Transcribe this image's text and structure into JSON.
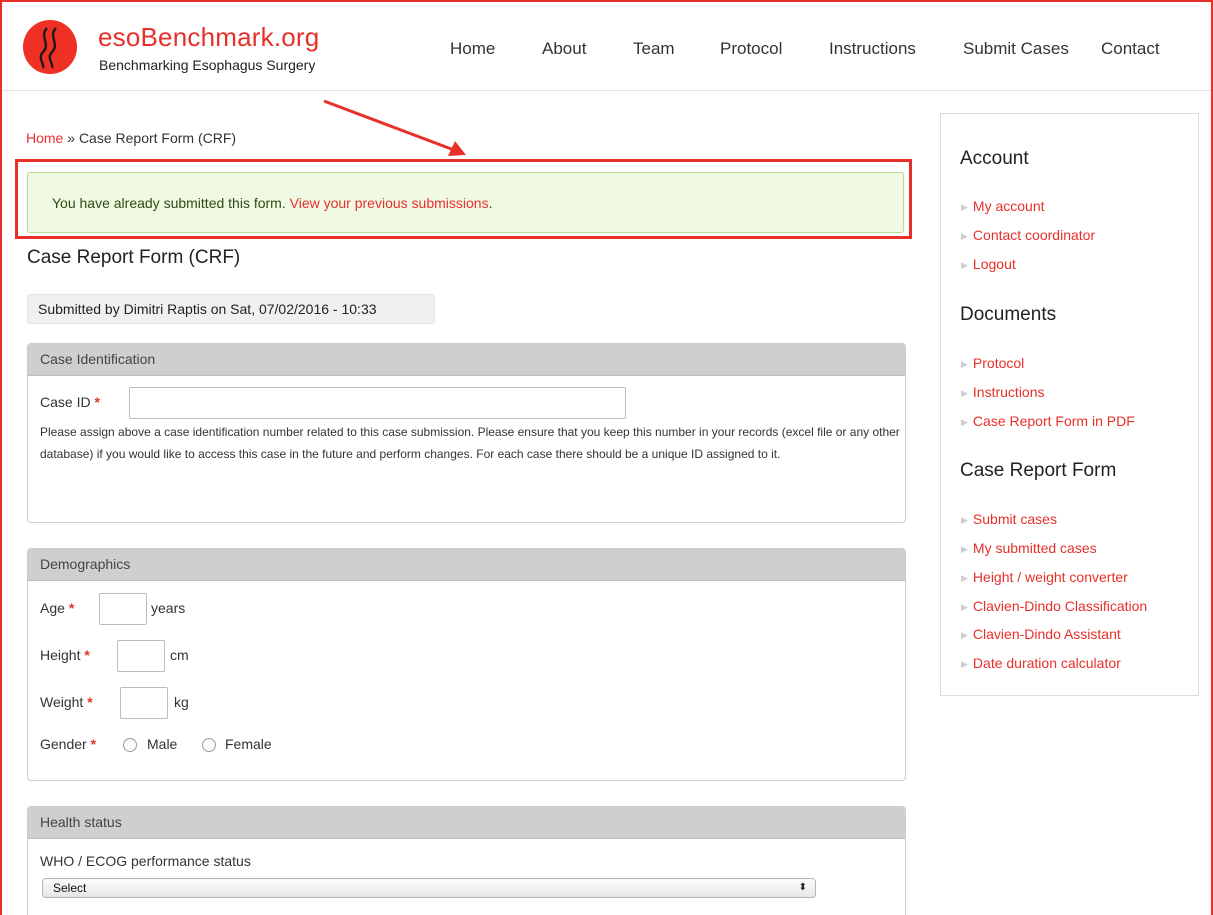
{
  "site": {
    "name": "esoBenchmark.org",
    "slogan": "Benchmarking Esophagus Surgery"
  },
  "nav": [
    "Home",
    "About",
    "Team",
    "Protocol",
    "Instructions",
    "Submit Cases",
    "Contact"
  ],
  "breadcrumb": {
    "home": "Home",
    "separator": "»",
    "current": "Case Report Form (CRF)"
  },
  "status": {
    "text": "You have already submitted this form.",
    "link": "View your previous submissions",
    "after": "."
  },
  "page_title": "Case Report Form (CRF)",
  "submitted_by": "Submitted by Dimitri Raptis on Sat, 07/02/2016 - 10:33",
  "case_identification": {
    "legend": "Case Identification",
    "case_id_label": "Case ID",
    "required": "*",
    "case_id_value": "",
    "description": "Please assign above a case identification number related to this case submission. Please ensure that you keep this number in your records (excel file or any other database) if you would like to access this case in the future and perform changes. For each case there should be a unique ID assigned to it."
  },
  "demographics": {
    "legend": "Demographics",
    "age_label": "Age",
    "age_unit": "years",
    "height_label": "Height",
    "height_unit": "cm",
    "weight_label": "Weight",
    "weight_unit": "kg",
    "gender_label": "Gender",
    "gender_options": [
      "Male",
      "Female"
    ],
    "required": "*"
  },
  "health_status": {
    "legend": "Health status",
    "who_label": "WHO / ECOG performance status",
    "select_value": "Select",
    "select_arrows": "⬍"
  },
  "sidebar": {
    "account": {
      "title": "Account",
      "links": [
        "My account",
        "Contact coordinator",
        "Logout"
      ]
    },
    "documents": {
      "title": "Documents",
      "links": [
        "Protocol",
        "Instructions",
        "Case Report Form in PDF"
      ]
    },
    "crf": {
      "title": "Case Report Form",
      "links": [
        "Submit cases",
        "My submitted cases",
        "Height / weight converter",
        "Clavien-Dindo Classification",
        "Clavien-Dindo Assistant",
        "Date duration calculator"
      ]
    },
    "bullet": "▶"
  },
  "colors": {
    "accent": "#e8302a",
    "status_bg": "#eff9e4",
    "legend_bg": "#cfcfcf"
  }
}
